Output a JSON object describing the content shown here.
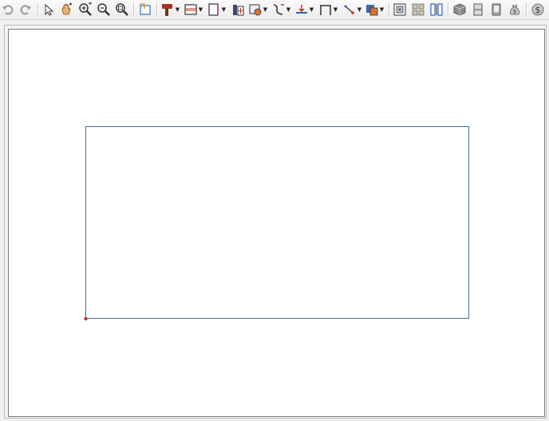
{
  "toolbar": {
    "buttons": [
      {
        "name": "undo-button",
        "icon": "undo-icon"
      },
      {
        "name": "redo-button",
        "icon": "redo-icon"
      },
      {
        "name": "select-button",
        "icon": "arrow-pointer-icon"
      },
      {
        "name": "pan-button",
        "icon": "pan-hand-icon"
      },
      {
        "name": "zoom-in-button",
        "icon": "zoom-in-icon"
      },
      {
        "name": "zoom-out-button",
        "icon": "zoom-out-icon"
      },
      {
        "name": "zoom-fill-button",
        "icon": "zoom-fill-icon"
      },
      {
        "name": "edit-area-button",
        "icon": "edit-area-icon"
      },
      {
        "name": "build-tools-button",
        "icon": "hammer-icon",
        "dropdown": true
      },
      {
        "name": "wall-tools-button",
        "icon": "wall-icon",
        "dropdown": true
      },
      {
        "name": "door-tools-button",
        "icon": "door-icon",
        "dropdown": true
      },
      {
        "name": "cabinet-tools-button",
        "icon": "cabinet-icon"
      },
      {
        "name": "window-tools-button",
        "icon": "window-icon",
        "dropdown": true
      },
      {
        "name": "stairs-tools-button",
        "icon": "stairs-icon",
        "dropdown": true
      },
      {
        "name": "terrain-tools-button",
        "icon": "terrain-icon",
        "dropdown": true
      },
      {
        "name": "dimension-tools-button",
        "icon": "dimension-icon",
        "dropdown": true
      },
      {
        "name": "cad-line-tools-button",
        "icon": "cad-line-icon",
        "dropdown": true
      },
      {
        "name": "library-tools-button",
        "icon": "library-icon",
        "dropdown": true
      },
      {
        "name": "camera-view-button",
        "icon": "camera-view-icon"
      },
      {
        "name": "plan-grid-button",
        "icon": "grid-icon"
      },
      {
        "name": "elevation-view-button",
        "icon": "elevation-icon"
      },
      {
        "name": "3d-view-button",
        "icon": "cube-icon"
      },
      {
        "name": "cross-section-button",
        "icon": "section-icon"
      },
      {
        "name": "layout-button",
        "icon": "layout-icon"
      },
      {
        "name": "materials-list-button",
        "icon": "money-bag-icon"
      }
    ]
  },
  "colors": {
    "canvas_background": "#ffffff",
    "rectangle_stroke": "#3f6f9f",
    "corner_point": "#c0392b"
  }
}
